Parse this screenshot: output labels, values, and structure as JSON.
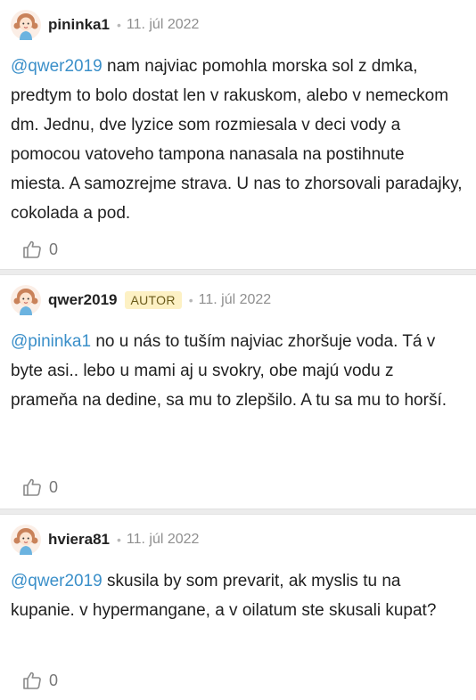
{
  "comments": [
    {
      "author": "pininka1",
      "badge": "",
      "date": "11. júl 2022",
      "mention": "@qwer2019",
      "text": " nam najviac pomohla morska sol z dmka, predtym to bolo dostat len v rakuskom, alebo v nemeckom dm. Jednu, dve lyzice som rozmiesala v deci vody a pomocou vatoveho tampona nanasala na postihnute miesta. A samozrejme strava. U nas to zhorsovali paradajky, cokolada a pod.",
      "likes": "0"
    },
    {
      "author": "qwer2019",
      "badge": "AUTOR",
      "date": "11. júl 2022",
      "mention": "@pininka1",
      "text": " no u nás to tuším najviac zhoršuje voda. Tá v byte asi.. lebo u mami aj u svokry, obe majú vodu z prameňa na dedine, sa mu to zlepšilo. A tu sa mu to horší.",
      "likes": "0"
    },
    {
      "author": "hviera81",
      "badge": "",
      "date": "11. júl 2022",
      "mention": "@qwer2019",
      "text": " skusila by som prevarit, ak myslis tu na kupanie. v hypermangane, a v oilatum ste skusali kupat?",
      "likes": "0"
    }
  ],
  "separator_dot": "•",
  "icons": {
    "avatar": "girl-avatar-icon",
    "like": "thumbs-up-icon"
  },
  "colors": {
    "mention": "#3a8fc9",
    "badge_bg": "#fdf1c4",
    "date": "#8f8f8f"
  }
}
